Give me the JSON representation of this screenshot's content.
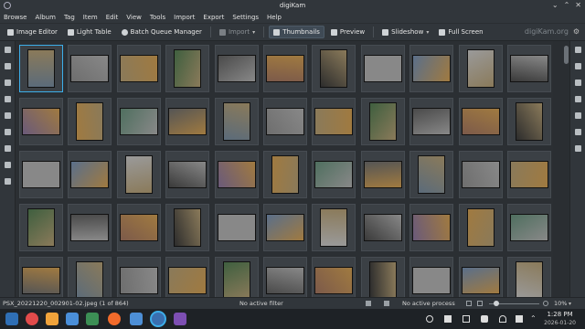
{
  "window": {
    "title": "digiKam"
  },
  "menu": [
    "Browse",
    "Album",
    "Tag",
    "Item",
    "Edit",
    "View",
    "Tools",
    "Import",
    "Export",
    "Settings",
    "Help"
  ],
  "toolbar": {
    "image_editor": "Image Editor",
    "light_table": "Light Table",
    "batch_queue": "Batch Queue Manager",
    "import": "Import",
    "thumbnails": "Thumbnails",
    "preview": "Preview",
    "slideshow": "Slideshow",
    "full_screen": "Full Screen",
    "brand": "digiKam.org"
  },
  "status": {
    "current_item": "PSX_20221220_002901-02.jpeg (1 of 864)",
    "filter": "No active filter",
    "process": "No active process",
    "zoom": "10%"
  },
  "clock": {
    "time": "1:28 PM",
    "date": "2026-01-20"
  },
  "colors": {
    "accent": "#3daee9",
    "background": "#2a2e32",
    "panel": "#31363b"
  }
}
